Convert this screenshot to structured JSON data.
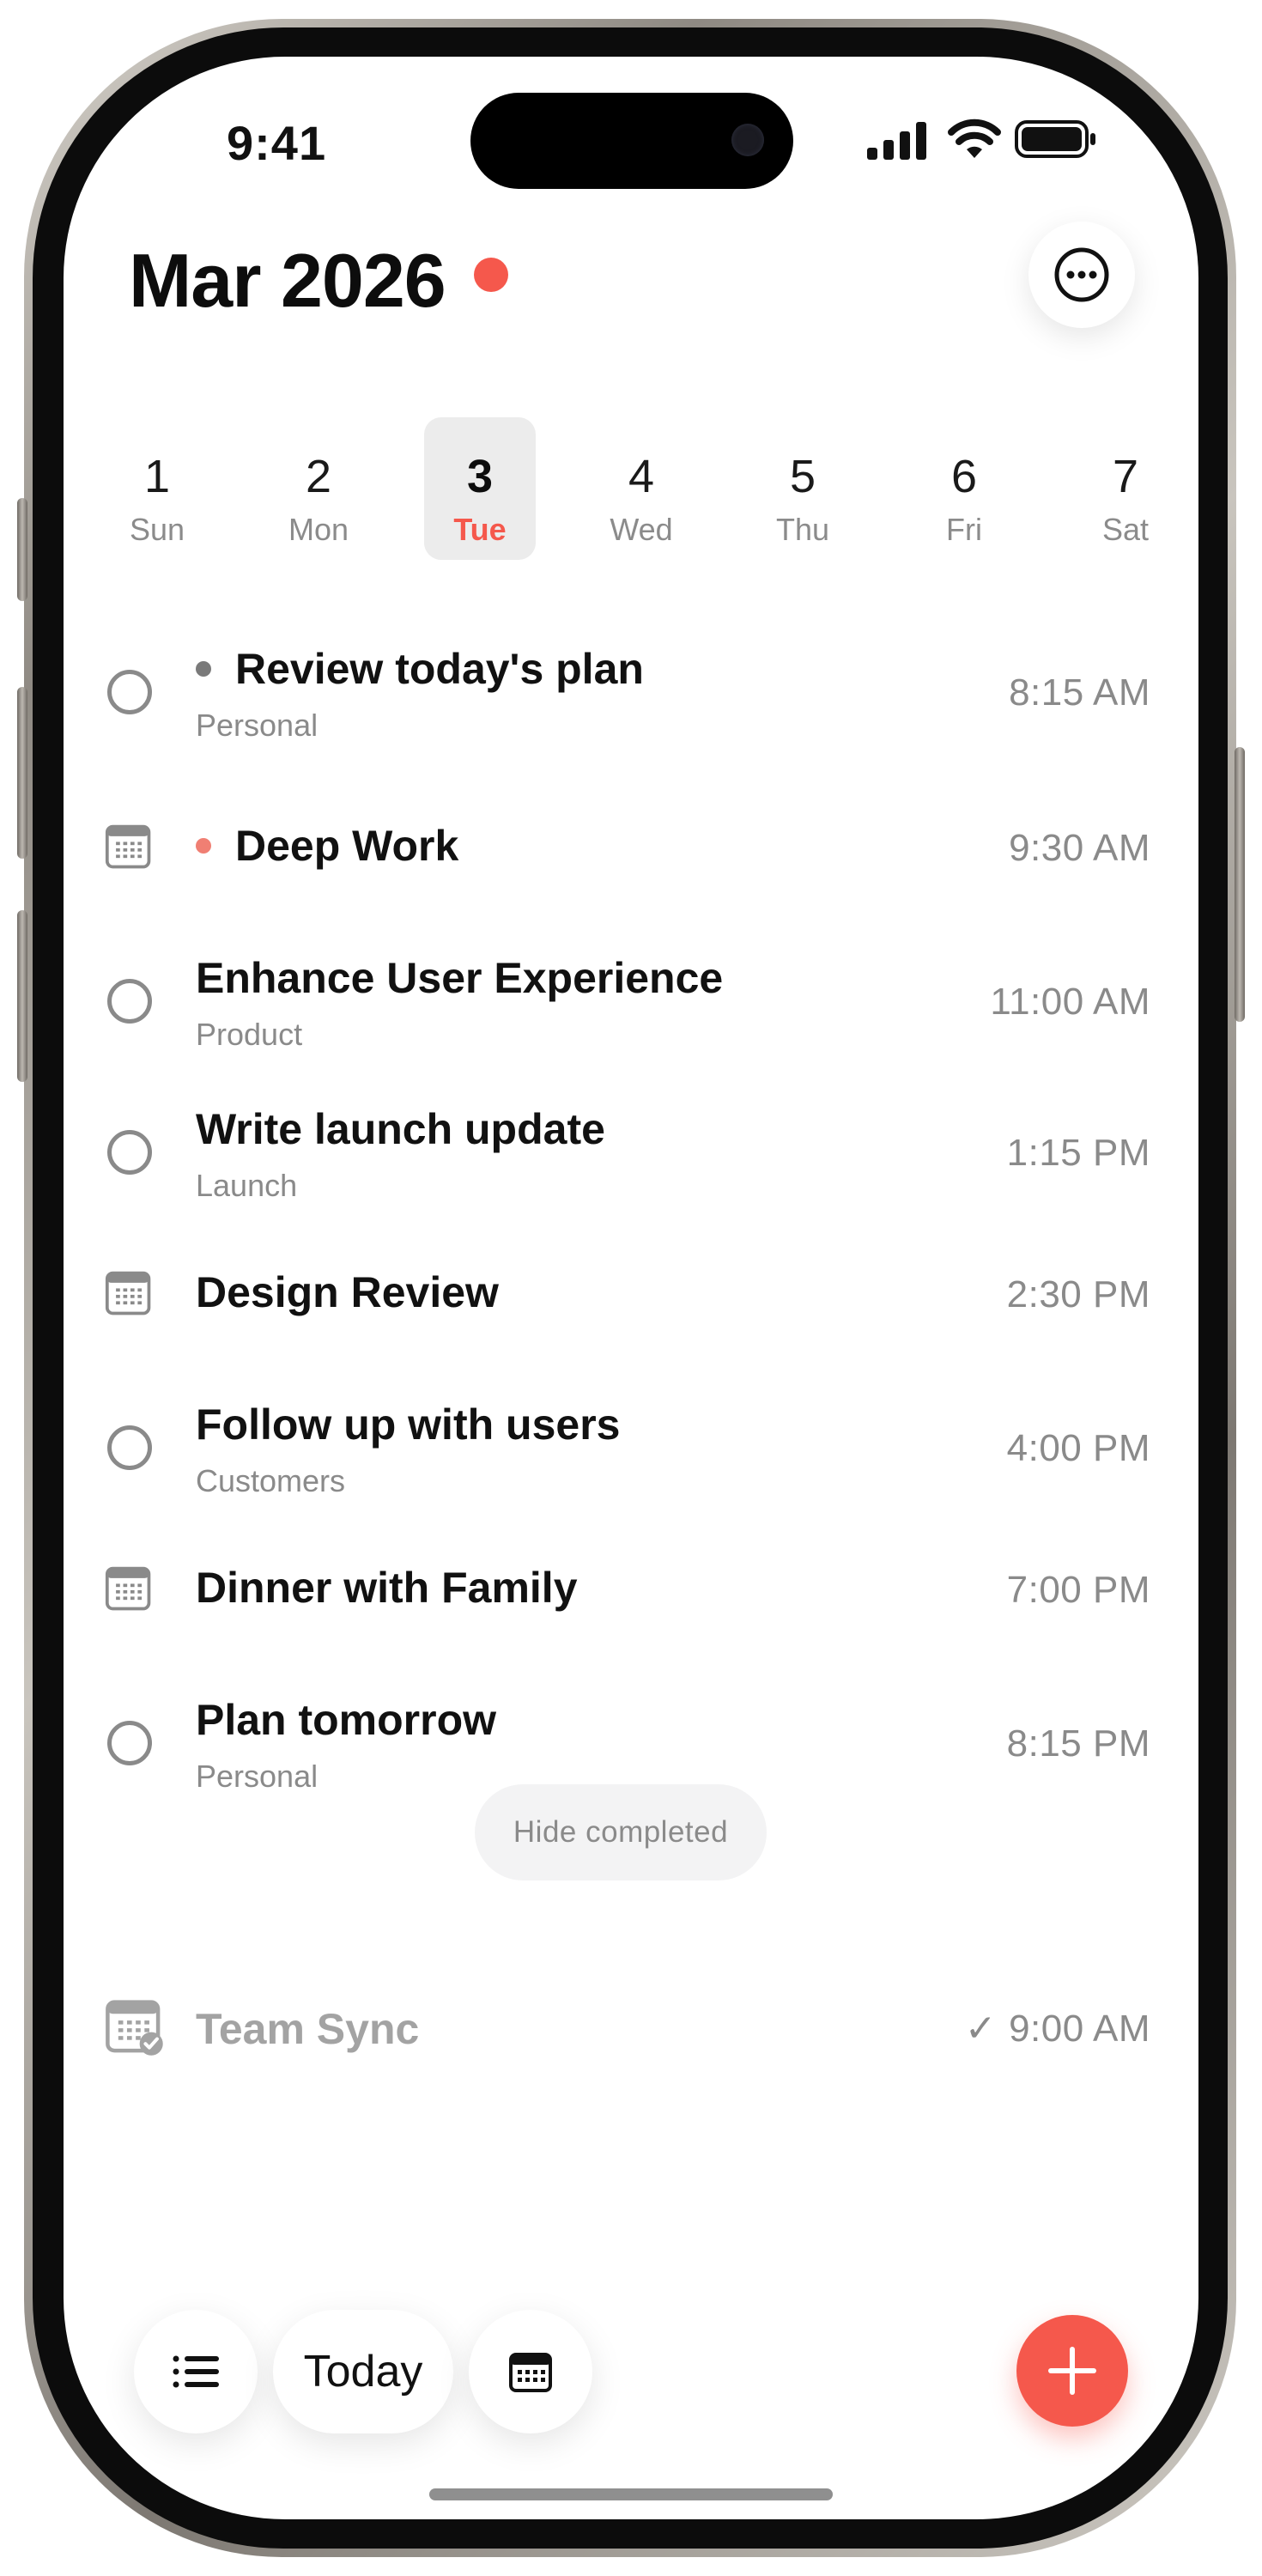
{
  "status_bar": {
    "time": "9:41"
  },
  "header": {
    "title": "Mar 2026"
  },
  "week": {
    "days": [
      {
        "num": "1",
        "label": "Sun"
      },
      {
        "num": "2",
        "label": "Mon"
      },
      {
        "num": "3",
        "label": "Tue"
      },
      {
        "num": "4",
        "label": "Wed"
      },
      {
        "num": "5",
        "label": "Thu"
      },
      {
        "num": "6",
        "label": "Fri"
      },
      {
        "num": "7",
        "label": "Sat"
      }
    ],
    "selected": "3"
  },
  "items": [
    {
      "type": "task",
      "title": "Review today's plan",
      "subtitle": "Personal",
      "time": "8:15 AM",
      "bullet": "#7a7a7a"
    },
    {
      "type": "event",
      "title": "Deep Work",
      "subtitle": "",
      "time": "9:30 AM",
      "bullet": "#f07f73"
    },
    {
      "type": "task",
      "title": "Enhance User Experience",
      "subtitle": "Product",
      "time": "11:00 AM"
    },
    {
      "type": "task",
      "title": "Write launch update",
      "subtitle": "Launch",
      "time": "1:15 PM"
    },
    {
      "type": "event",
      "title": "Design Review",
      "subtitle": "",
      "time": "2:30 PM"
    },
    {
      "type": "task",
      "title": "Follow up with users",
      "subtitle": "Customers",
      "time": "4:00 PM"
    },
    {
      "type": "event",
      "title": "Dinner with Family",
      "subtitle": "",
      "time": "7:00 PM"
    },
    {
      "type": "task",
      "title": "Plan tomorrow",
      "subtitle": "Personal",
      "time": "8:15 PM"
    }
  ],
  "hide_completed_label": "Hide completed",
  "completed": [
    {
      "title": "Team Sync",
      "check": "✓",
      "time": "9:00 AM"
    }
  ],
  "bottom_bar": {
    "today_label": "Today"
  },
  "colors": {
    "accent": "#f5584c",
    "muted": "#8a8a8a",
    "text": "#111111"
  }
}
